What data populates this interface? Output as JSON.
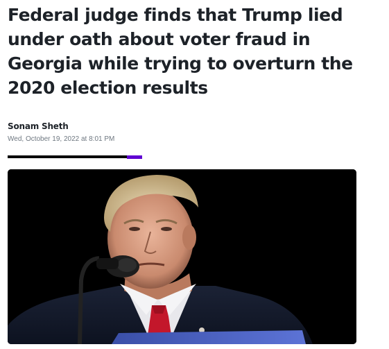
{
  "article": {
    "headline": "Federal judge finds that Trump lied under oath about voter fraud in Georgia while trying to overturn the 2020 election results",
    "author": "Sonam Sheth",
    "published": "Wed, October 19, 2022 at 8:01 PM"
  },
  "reading_progress": {
    "fraction": 0.89,
    "bar_color": "#000000",
    "accent_color": "#6001d2"
  },
  "hero_image": {
    "subject": "man-speaking-at-microphone-photo",
    "background_color": "#000000"
  }
}
